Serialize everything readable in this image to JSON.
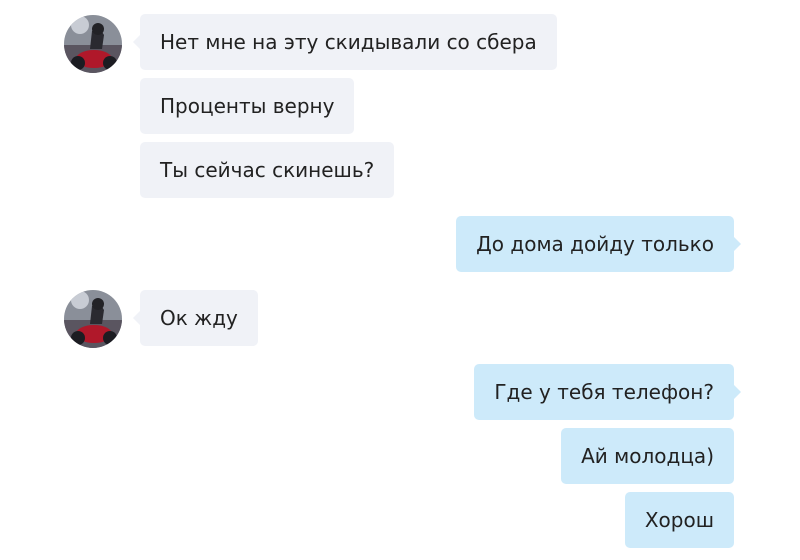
{
  "contact": {
    "avatar_icon": "contact-avatar-motorcycle-icon"
  },
  "colors": {
    "incoming_bubble": "#f0f2f7",
    "outgoing_bubble": "#cdeafa",
    "text": "#222222"
  },
  "messages": [
    {
      "direction": "incoming",
      "text": "Нет мне на эту скидывали со сбера",
      "show_avatar": true
    },
    {
      "direction": "incoming",
      "text": "Проценты верну",
      "show_avatar": false
    },
    {
      "direction": "incoming",
      "text": "Ты сейчас скинешь?",
      "show_avatar": false
    },
    {
      "direction": "outgoing",
      "text": "До дома дойду только"
    },
    {
      "direction": "incoming",
      "text": "Ок жду",
      "show_avatar": true
    },
    {
      "direction": "outgoing",
      "text": "Где у тебя телефон?"
    },
    {
      "direction": "outgoing",
      "text": "Ай молодца)"
    },
    {
      "direction": "outgoing",
      "text": "Хорош"
    }
  ]
}
